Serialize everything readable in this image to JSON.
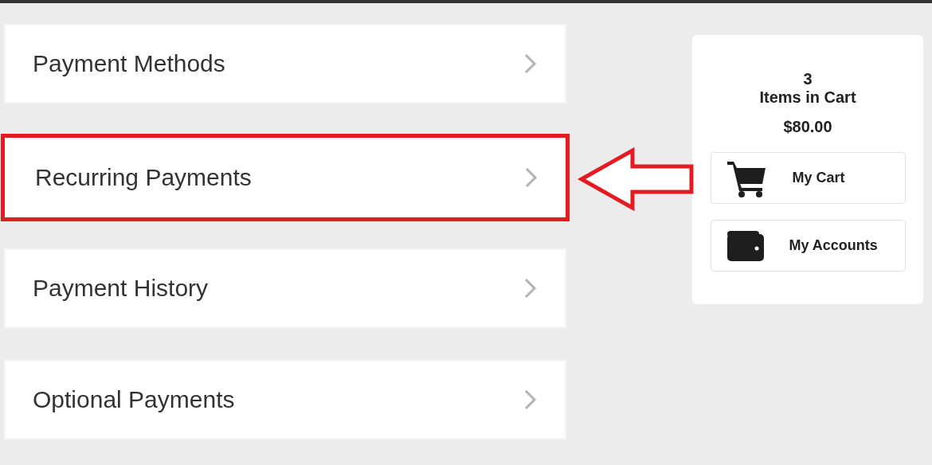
{
  "menu": [
    {
      "label": "Payment Methods",
      "highlighted": false
    },
    {
      "label": "Recurring Payments",
      "highlighted": true
    },
    {
      "label": "Payment History",
      "highlighted": false
    },
    {
      "label": "Optional Payments",
      "highlighted": false
    }
  ],
  "cart": {
    "count": "3",
    "caption": "Items in Cart",
    "total": "$80.00",
    "buttons": [
      {
        "label": "My Cart",
        "kind": "cart"
      },
      {
        "label": "My Accounts",
        "kind": "accounts"
      }
    ]
  }
}
